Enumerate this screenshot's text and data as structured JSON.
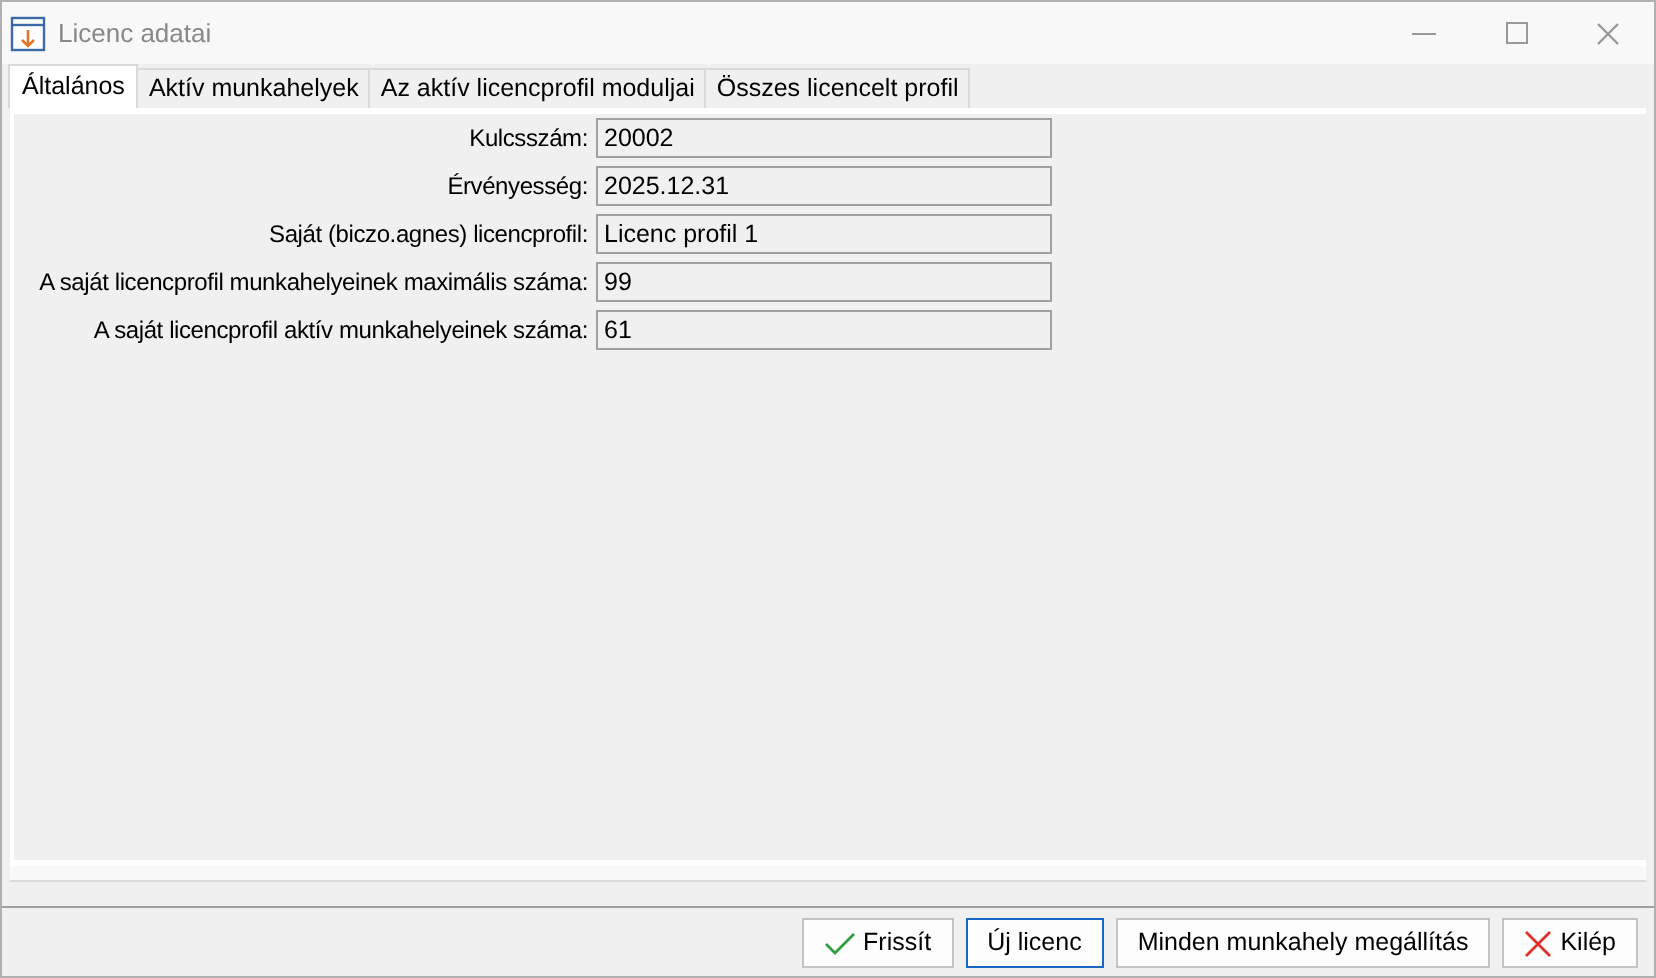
{
  "window": {
    "title": "Licenc adatai"
  },
  "tabs": [
    {
      "label": "Általános",
      "selected": true
    },
    {
      "label": "Aktív munkahelyek",
      "selected": false
    },
    {
      "label": "Az aktív licencprofil moduljai",
      "selected": false
    },
    {
      "label": "Összes licencelt profil",
      "selected": false
    }
  ],
  "fields": [
    {
      "label": "Kulcsszám:",
      "value": "20002"
    },
    {
      "label": "Érvényesség:",
      "value": "2025.12.31"
    },
    {
      "label": "Saját (biczo.agnes) licencprofil:",
      "value": "Licenc profil 1"
    },
    {
      "label": "A saját licencprofil munkahelyeinek maximális száma:",
      "value": "99"
    },
    {
      "label": "A saját licencprofil aktív munkahelyeinek száma:",
      "value": "61"
    }
  ],
  "buttons": [
    {
      "label": "Frissít",
      "kind": "check",
      "focused": false
    },
    {
      "label": "Új licenc",
      "kind": "plain",
      "focused": true
    },
    {
      "label": "Minden munkahely megállítás",
      "kind": "plain",
      "focused": false
    },
    {
      "label": "Kilép",
      "kind": "cross",
      "focused": false
    }
  ]
}
